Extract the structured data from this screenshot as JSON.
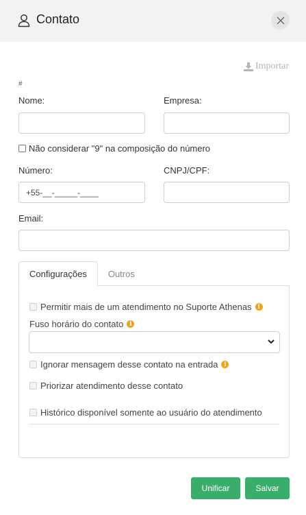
{
  "header": {
    "title": "Contato",
    "icon": "user-icon",
    "close_icon": "close-icon"
  },
  "toolbar": {
    "import_label": "Importar",
    "import_icon": "download-icon"
  },
  "form": {
    "hash_mark": "#",
    "name_label": "Nome:",
    "name_value": "",
    "company_label": "Empresa:",
    "company_value": "",
    "ninth_digit_label": "Não considerar \"9\" na composição do número",
    "ninth_digit_checked": false,
    "number_label": "Número:",
    "number_value": "+55-__-_____-____",
    "cnpj_label": "CNPJ/CPF:",
    "cnpj_value": "",
    "email_label": "Email:",
    "email_value": ""
  },
  "tabs": [
    {
      "label": "Configurações",
      "active": true
    },
    {
      "label": "Outros",
      "active": false
    }
  ],
  "settings": {
    "allow_multiple_label": "Permitir mais de um atendimento no Suporte Athenas",
    "timezone_label": "Fuso horário do contato",
    "timezone_value": "",
    "ignore_messages_label": "Ignorar mensagem desse contato na entrada",
    "prioritize_label": "Priorizar atendimento desse contato",
    "history_label": "Histórico disponível somente ao usuário do atendimento"
  },
  "actions": {
    "merge_label": "Unificar",
    "save_label": "Salvar"
  },
  "colors": {
    "header_bg": "#f2f2f2",
    "primary_button": "#3bad6a",
    "info_icon": "#f0a21a"
  }
}
